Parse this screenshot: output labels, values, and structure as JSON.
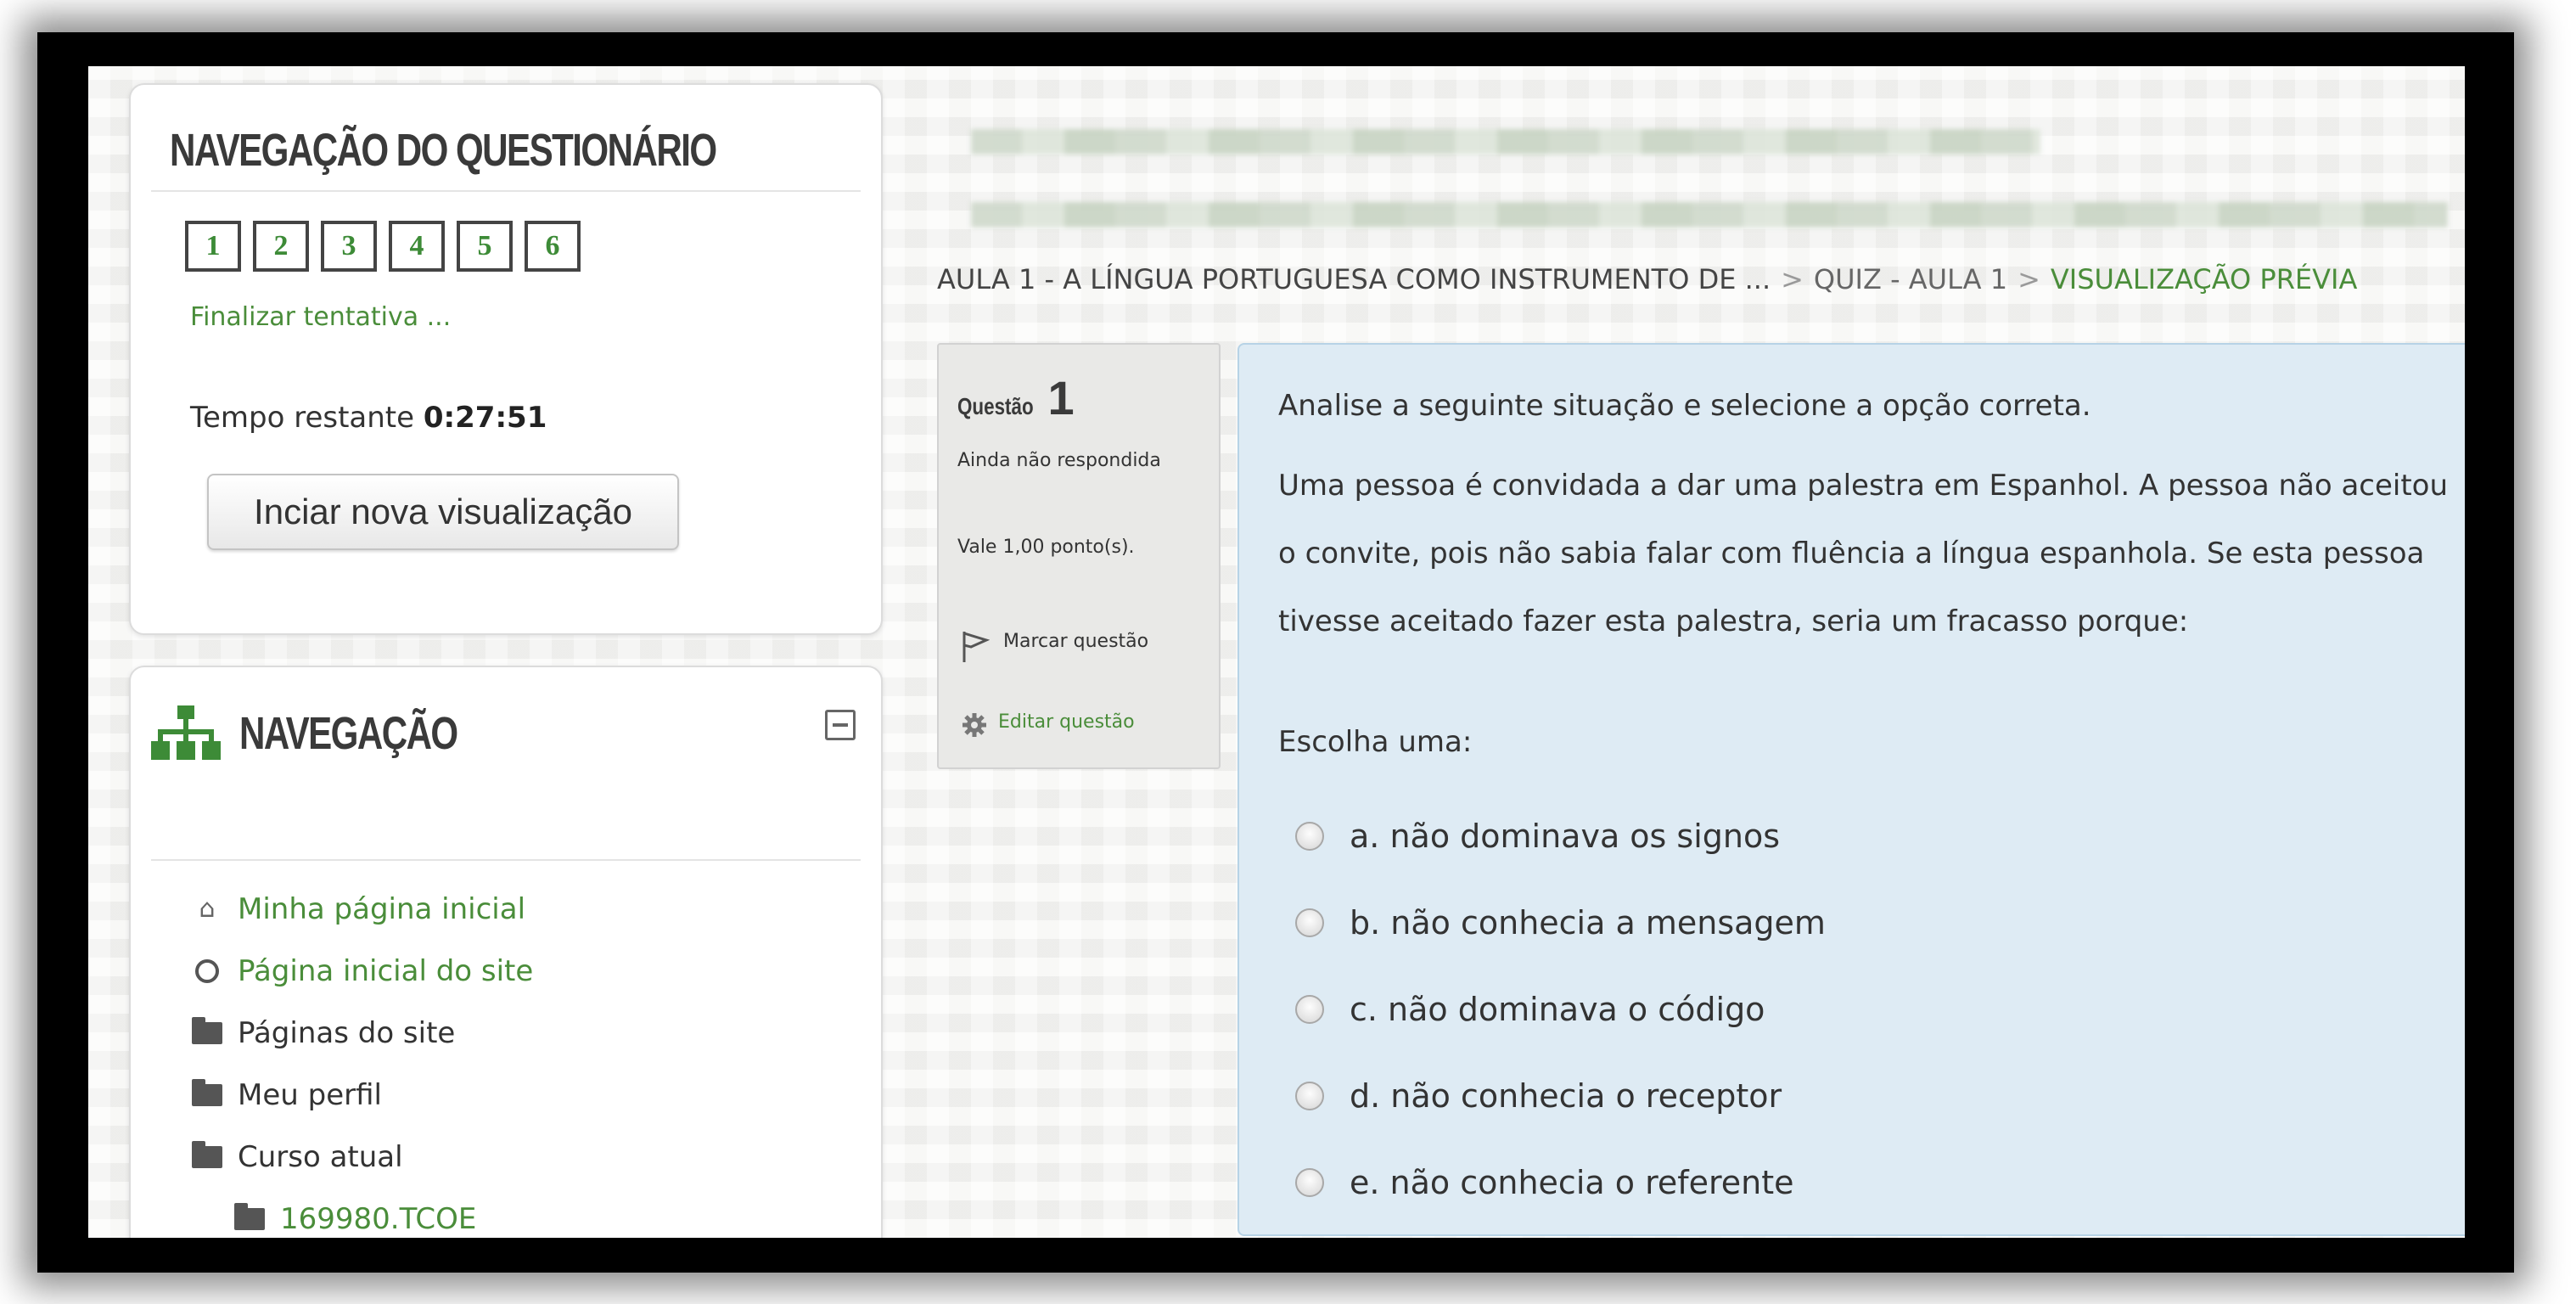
{
  "quiz_nav": {
    "title": "NAVEGAÇÃO DO QUESTIONÁRIO",
    "questions": [
      "1",
      "2",
      "3",
      "4",
      "5",
      "6"
    ],
    "finish_link": "Finalizar tentativa ...",
    "time_label": "Tempo restante",
    "time_value": "0:27:51",
    "start_button": "Inciar nova visualização"
  },
  "navigation": {
    "title": "NAVEGAÇÃO",
    "items": [
      {
        "label": "Minha página inicial",
        "icon": "home-icon",
        "link": true
      },
      {
        "label": "Página inicial do site",
        "icon": "circle-icon",
        "link": true
      },
      {
        "label": "Páginas do site",
        "icon": "folder-icon",
        "link": false
      },
      {
        "label": "Meu perfil",
        "icon": "folder-icon",
        "link": false
      },
      {
        "label": "Curso atual",
        "icon": "folder-icon",
        "link": false
      },
      {
        "label": "169980.TCOE",
        "icon": "folder-icon",
        "link": true
      }
    ]
  },
  "breadcrumb": {
    "items": [
      "AULA 1 - A LÍNGUA PORTUGUESA COMO INSTRUMENTO DE ...",
      "QUIZ - AULA 1",
      "VISUALIZAÇÃO PRÉVIA"
    ],
    "separator": ">"
  },
  "question_info": {
    "label": "Questão",
    "number": "1",
    "status": "Ainda não respondida",
    "points": "Vale 1,00 ponto(s).",
    "flag_label": "Marcar questão",
    "edit_label": "Editar questão"
  },
  "question": {
    "intro": "Analise a seguinte situação e selecione a opção correta.",
    "body": "Uma pessoa é convidada a dar uma palestra em Espanhol. A pessoa não aceitou o convite, pois não sabia falar com fluência a língua espanhola. Se esta pessoa tivesse aceitado fazer esta palestra, seria um fracasso porque:",
    "prompt": "Escolha uma:",
    "answers": [
      "a. não dominava os signos",
      "b. não conhecia a mensagem",
      "c. não dominava o código",
      "d. não conhecia o receptor",
      "e. não conhecia o referente"
    ]
  },
  "colors": {
    "accent_green": "#3d8b37",
    "link_green": "#4a8d3a",
    "question_bg": "#deebf4"
  }
}
